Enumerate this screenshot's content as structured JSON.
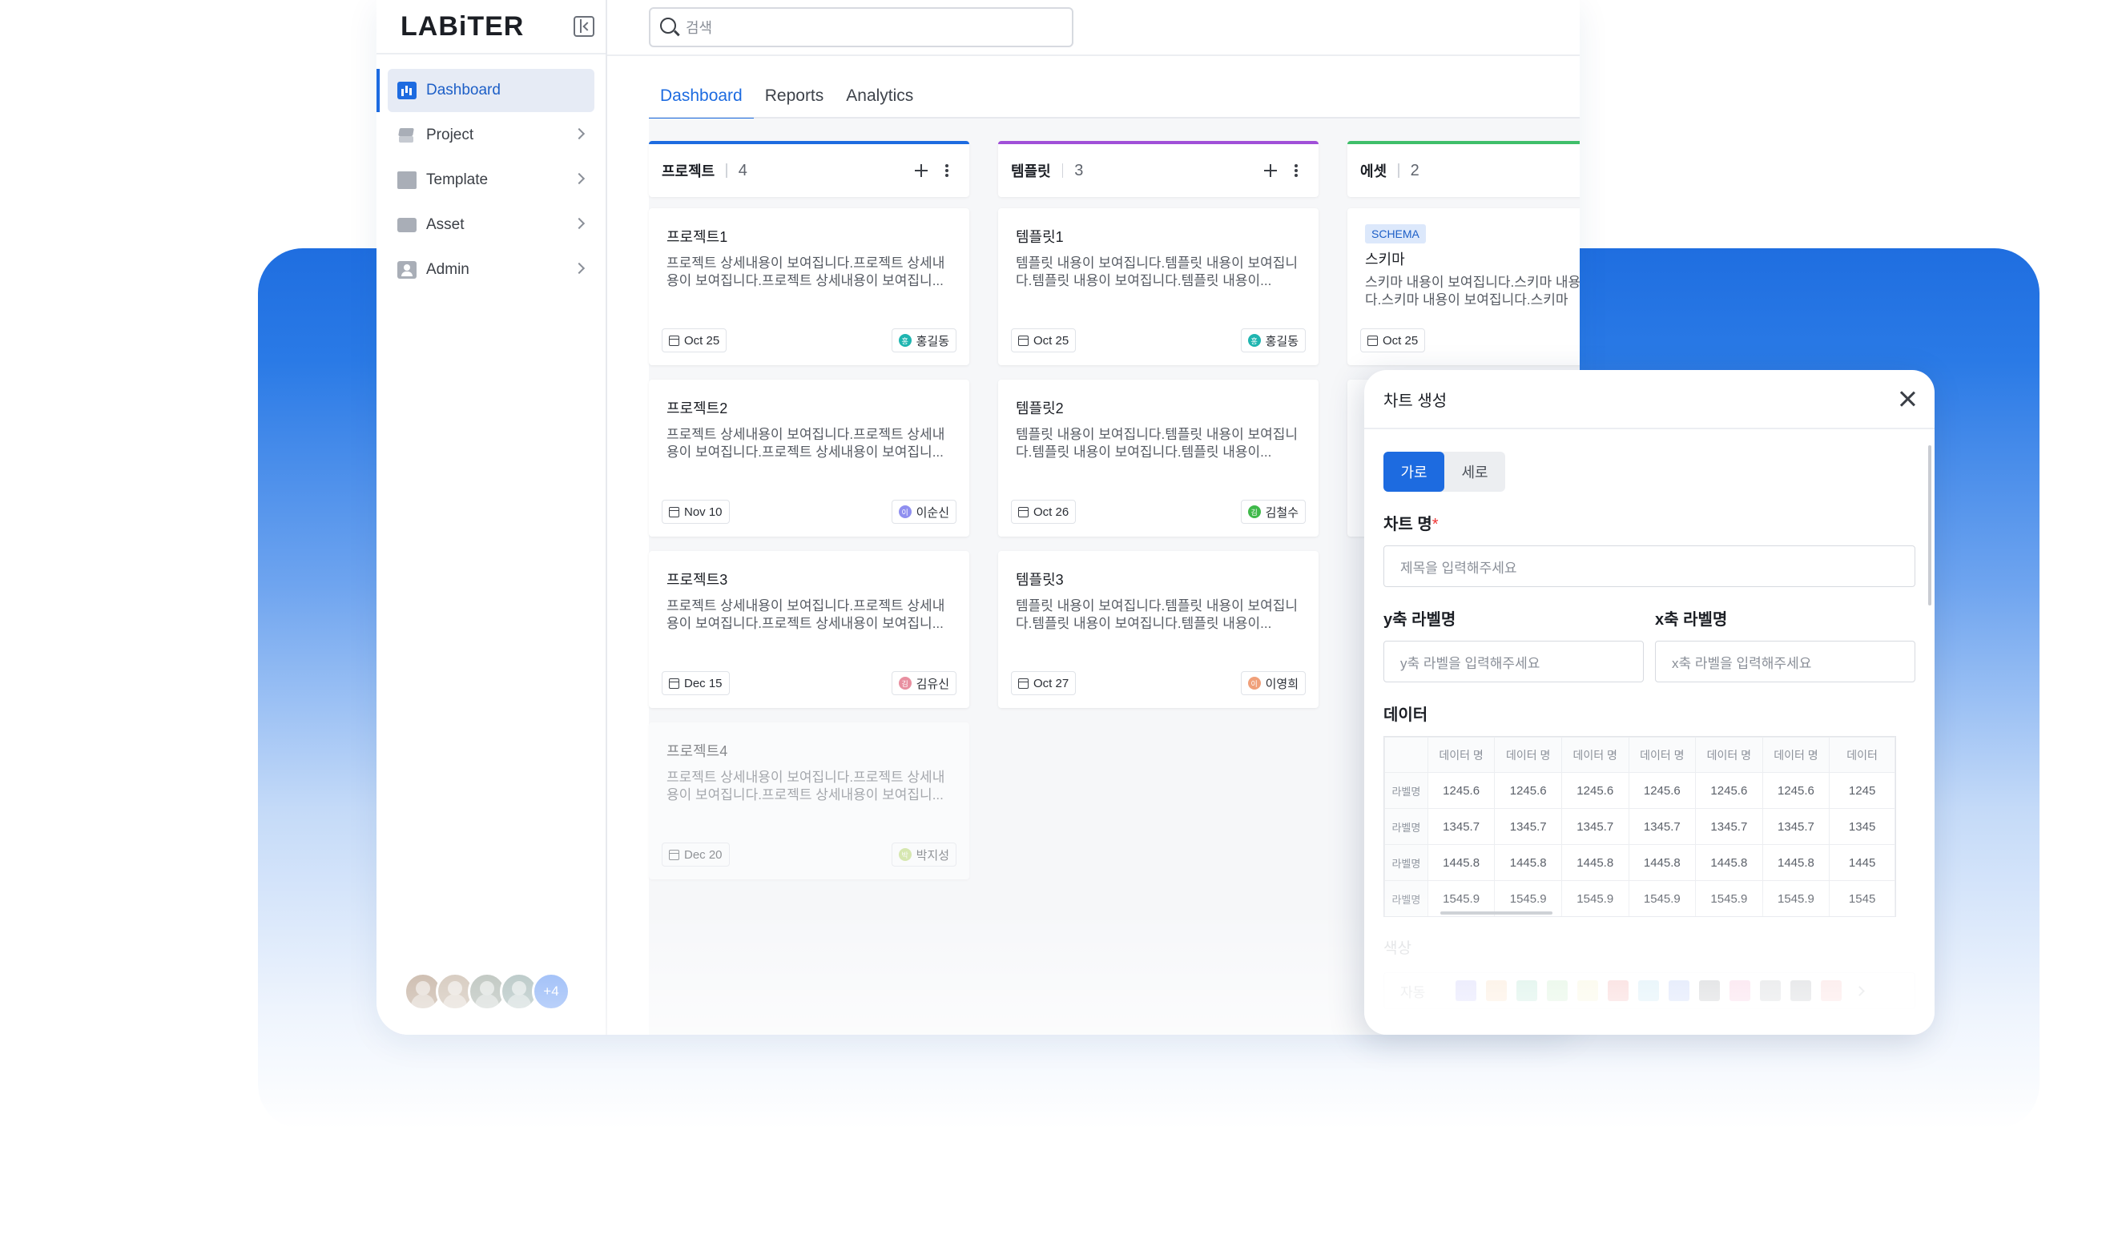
{
  "brand": {
    "logo": "LABiTER"
  },
  "search": {
    "placeholder": "검색"
  },
  "sidebar": {
    "items": [
      {
        "label": "Dashboard"
      },
      {
        "label": "Project"
      },
      {
        "label": "Template"
      },
      {
        "label": "Asset"
      },
      {
        "label": "Admin"
      }
    ],
    "avatars_more": "+4"
  },
  "tabs": [
    {
      "label": "Dashboard"
    },
    {
      "label": "Reports"
    },
    {
      "label": "Analytics"
    }
  ],
  "columns": [
    {
      "title": "프로젝트",
      "count": "4",
      "accent": "#1d6be0",
      "cards": [
        {
          "title": "프로젝트1",
          "desc": "프로젝트 상세내용이 보여집니다.프로젝트 상세내용이 보여집니다.프로젝트 상세내용이 보여집니...",
          "date": "Oct 25",
          "owner": "홍길동",
          "owner_initial": "홍",
          "owner_color": "#1fb5b0"
        },
        {
          "title": "프로젝트2",
          "desc": "프로젝트 상세내용이 보여집니다.프로젝트 상세내용이 보여집니다.프로젝트 상세내용이 보여집니...",
          "date": "Nov 10",
          "owner": "이순신",
          "owner_initial": "이",
          "owner_color": "#8f8ff0"
        },
        {
          "title": "프로젝트3",
          "desc": "프로젝트 상세내용이 보여집니다.프로젝트 상세내용이 보여집니다.프로젝트 상세내용이 보여집니...",
          "date": "Dec 15",
          "owner": "김유신",
          "owner_initial": "김",
          "owner_color": "#e88fa0"
        },
        {
          "title": "프로젝트4",
          "desc": "프로젝트 상세내용이 보여집니다.프로젝트 상세내용이 보여집니다.프로젝트 상세내용이 보여집니...",
          "date": "Dec 20",
          "owner": "박지성",
          "owner_initial": "박",
          "owner_color": "#b8d86a"
        }
      ]
    },
    {
      "title": "템플릿",
      "count": "3",
      "accent": "#a04fd8",
      "cards": [
        {
          "title": "템플릿1",
          "desc": "템플릿 내용이 보여집니다.템플릿 내용이 보여집니다.템플릿 내용이 보여집니다.템플릿 내용이...",
          "date": "Oct 25",
          "owner": "홍길동",
          "owner_initial": "홍",
          "owner_color": "#1fb5b0"
        },
        {
          "title": "템플릿2",
          "desc": "템플릿 내용이 보여집니다.템플릿 내용이 보여집니다.템플릿 내용이 보여집니다.템플릿 내용이...",
          "date": "Oct 26",
          "owner": "김철수",
          "owner_initial": "김",
          "owner_color": "#3fb94a"
        },
        {
          "title": "템플릿3",
          "desc": "템플릿 내용이 보여집니다.템플릿 내용이 보여집니다.템플릿 내용이 보여집니다.템플릿 내용이...",
          "date": "Oct 27",
          "owner": "이영희",
          "owner_initial": "이",
          "owner_color": "#f0a07a"
        }
      ]
    },
    {
      "title": "에셋",
      "count": "2",
      "accent": "#3fbf6a",
      "cards": [
        {
          "badge": "SCHEMA",
          "title": "스키마",
          "desc": "스키마 내용이 보여집니다.스키마 내용이 보여집니다.스키마 내용이 보여집니다.스키마",
          "date": "Oct 25"
        }
      ]
    }
  ],
  "modal": {
    "title": "차트 생성",
    "orientation": [
      "가로",
      "세로"
    ],
    "chart_name_label": "차트 명",
    "chart_name_placeholder": "제목을 입력해주세요",
    "y_label": "y축 라벨명",
    "y_placeholder": "y축 라벨을 입력해주세요",
    "x_label": "x축 라벨명",
    "x_placeholder": "x축 라벨을 입력해주세요",
    "data_label": "데이터",
    "table": {
      "header": [
        "데이터 명",
        "데이터 명",
        "데이터 명",
        "데이터 명",
        "데이터 명",
        "데이터 명",
        "데이터"
      ],
      "rows": [
        {
          "label": "라벨명",
          "values": [
            "1245.6",
            "1245.6",
            "1245.6",
            "1245.6",
            "1245.6",
            "1245.6",
            "1245"
          ]
        },
        {
          "label": "라벨명",
          "values": [
            "1345.7",
            "1345.7",
            "1345.7",
            "1345.7",
            "1345.7",
            "1345.7",
            "1345"
          ]
        },
        {
          "label": "라벨명",
          "values": [
            "1445.8",
            "1445.8",
            "1445.8",
            "1445.8",
            "1445.8",
            "1445.8",
            "1445"
          ]
        },
        {
          "label": "라벨명",
          "values": [
            "1545.9",
            "1545.9",
            "1545.9",
            "1545.9",
            "1545.9",
            "1545.9",
            "1545"
          ]
        }
      ]
    },
    "color_label": "색상",
    "color_auto": "자동",
    "swatches": [
      "#8f8ff5",
      "#f5b97a",
      "#5fc8a0",
      "#8fd890",
      "#f0e8a0",
      "#e85a5a",
      "#7ac8e8",
      "#6a8ff0",
      "#5a5f68",
      "#f07ab0",
      "#8a8f98",
      "#707580",
      "#f59a9a"
    ]
  }
}
